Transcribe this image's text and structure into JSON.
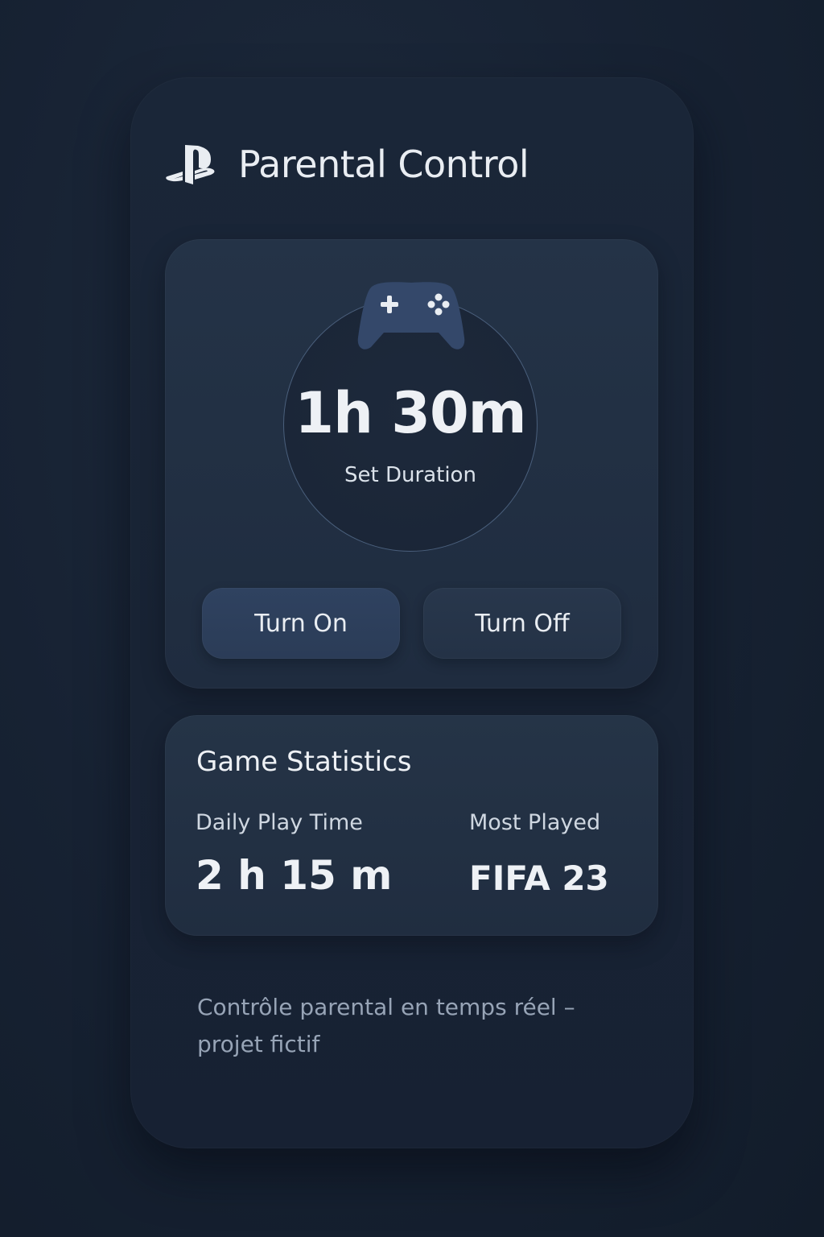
{
  "header": {
    "logo_icon": "playstation-logo-icon",
    "title": "Parental Control"
  },
  "timer": {
    "icon": "gamepad-icon",
    "duration": "1h 30m",
    "duration_label": "Set Duration",
    "turn_on_label": "Turn On",
    "turn_off_label": "Turn Off"
  },
  "stats": {
    "title": "Game Statistics",
    "daily_play_time_label": "Daily Play Time",
    "daily_play_time_value": "2 h 15 m",
    "most_played_label": "Most Played",
    "most_played_value": "FIFA 23"
  },
  "footnote": "Contrôle parental en temps réel – projet fictif",
  "colors": {
    "background": "#172233",
    "card": "#1a2638",
    "panel": "#243347",
    "button_on": "#2f4260",
    "button_off": "#28374c",
    "text": "#e9edf2",
    "muted_text": "#97a4b6",
    "dial_ring": "#4a5f7c"
  }
}
